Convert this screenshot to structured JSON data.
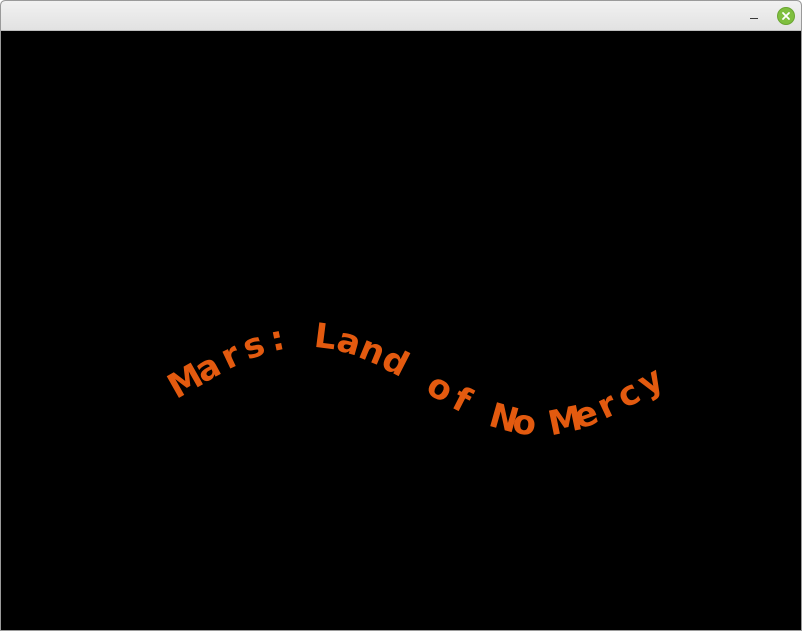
{
  "window": {
    "minimize_label": "–"
  },
  "game": {
    "title_text": "Mars: Land of No Mercy",
    "text_color": "#e35a0f",
    "background_color": "#000000"
  }
}
